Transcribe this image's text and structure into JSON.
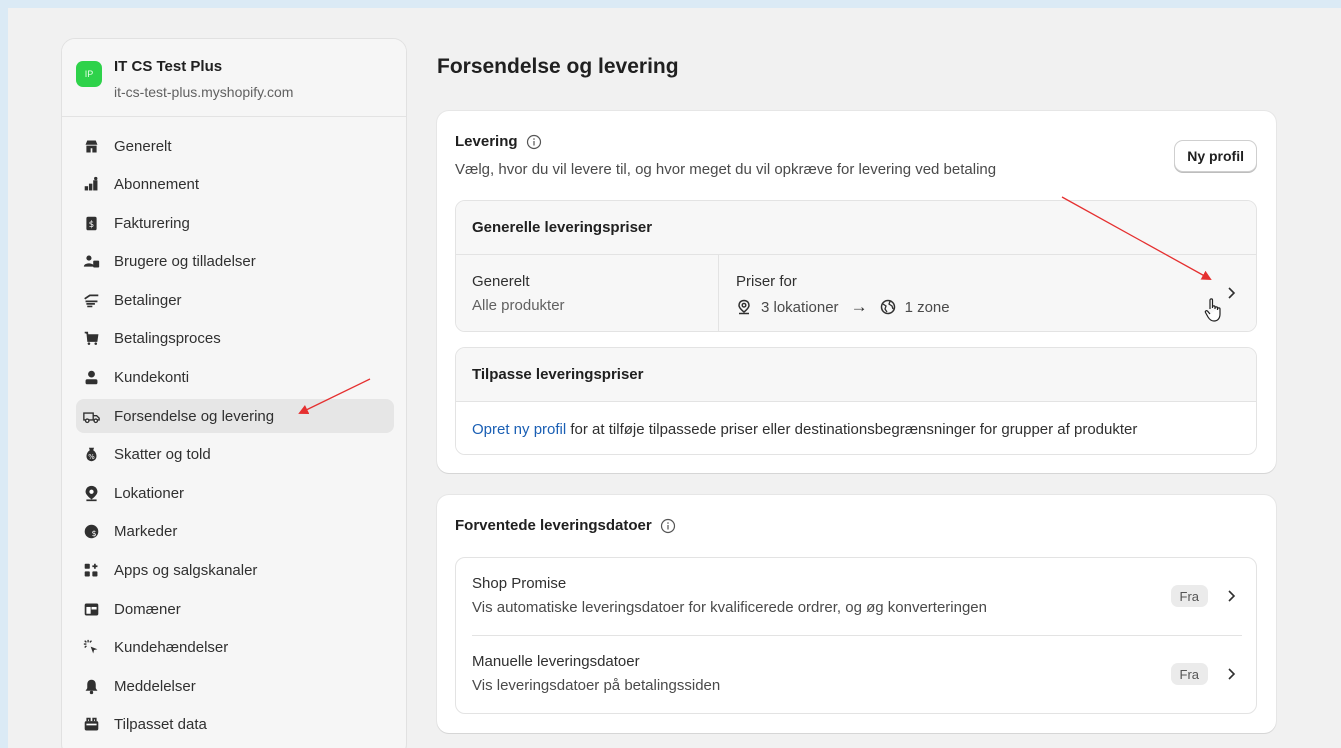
{
  "store": {
    "badge": "IP",
    "name": "IT CS Test Plus",
    "url": "it-cs-test-plus.myshopify.com"
  },
  "sidebar": {
    "items": [
      {
        "label": "Generelt",
        "icon": "store-icon"
      },
      {
        "label": "Abonnement",
        "icon": "plan-icon"
      },
      {
        "label": "Fakturering",
        "icon": "billing-icon"
      },
      {
        "label": "Brugere og tilladelser",
        "icon": "users-icon"
      },
      {
        "label": "Betalinger",
        "icon": "payments-icon"
      },
      {
        "label": "Betalingsproces",
        "icon": "cart-icon"
      },
      {
        "label": "Kundekonti",
        "icon": "person-icon"
      },
      {
        "label": "Forsendelse og levering",
        "icon": "truck-icon",
        "active": true
      },
      {
        "label": "Skatter og told",
        "icon": "tax-icon"
      },
      {
        "label": "Lokationer",
        "icon": "location-icon"
      },
      {
        "label": "Markeder",
        "icon": "globe-icon"
      },
      {
        "label": "Apps og salgskanaler",
        "icon": "apps-icon"
      },
      {
        "label": "Domæner",
        "icon": "domain-icon"
      },
      {
        "label": "Kundehændelser",
        "icon": "cursor-icon"
      },
      {
        "label": "Meddelelser",
        "icon": "bell-icon"
      },
      {
        "label": "Tilpasset data",
        "icon": "data-icon"
      }
    ]
  },
  "page": {
    "title": "Forsendelse og levering"
  },
  "delivery": {
    "title": "Levering",
    "description": "Vælg, hvor du vil levere til, og hvor meget du vil opkræve for levering ved betaling",
    "new_profile_button": "Ny profil",
    "general_rates": {
      "heading": "Generelle leveringspriser",
      "name": "Generelt",
      "products": "Alle produkter",
      "prices_for": "Priser for",
      "locations": "3 lokationer",
      "arrow": "→",
      "zones": "1 zone"
    },
    "custom_rates": {
      "heading": "Tilpasse leveringspriser",
      "link_text": "Opret ny profil",
      "rest_text": " for at tilføje tilpassede priser eller destinationsbegrænsninger for grupper af produkter"
    }
  },
  "expected_dates": {
    "title": "Forventede leveringsdatoer",
    "rows": [
      {
        "title": "Shop Promise",
        "desc": "Vis automatiske leveringsdatoer for kvalificerede ordrer, og øg konverteringen",
        "status": "Fra"
      },
      {
        "title": "Manuelle leveringsdatoer",
        "desc": "Vis leveringsdatoer på betalingssiden",
        "status": "Fra"
      }
    ]
  },
  "colors": {
    "accent_link": "#1a5fb4",
    "store_badge": "#2ed24a",
    "annotation_arrow": "#e53030"
  }
}
